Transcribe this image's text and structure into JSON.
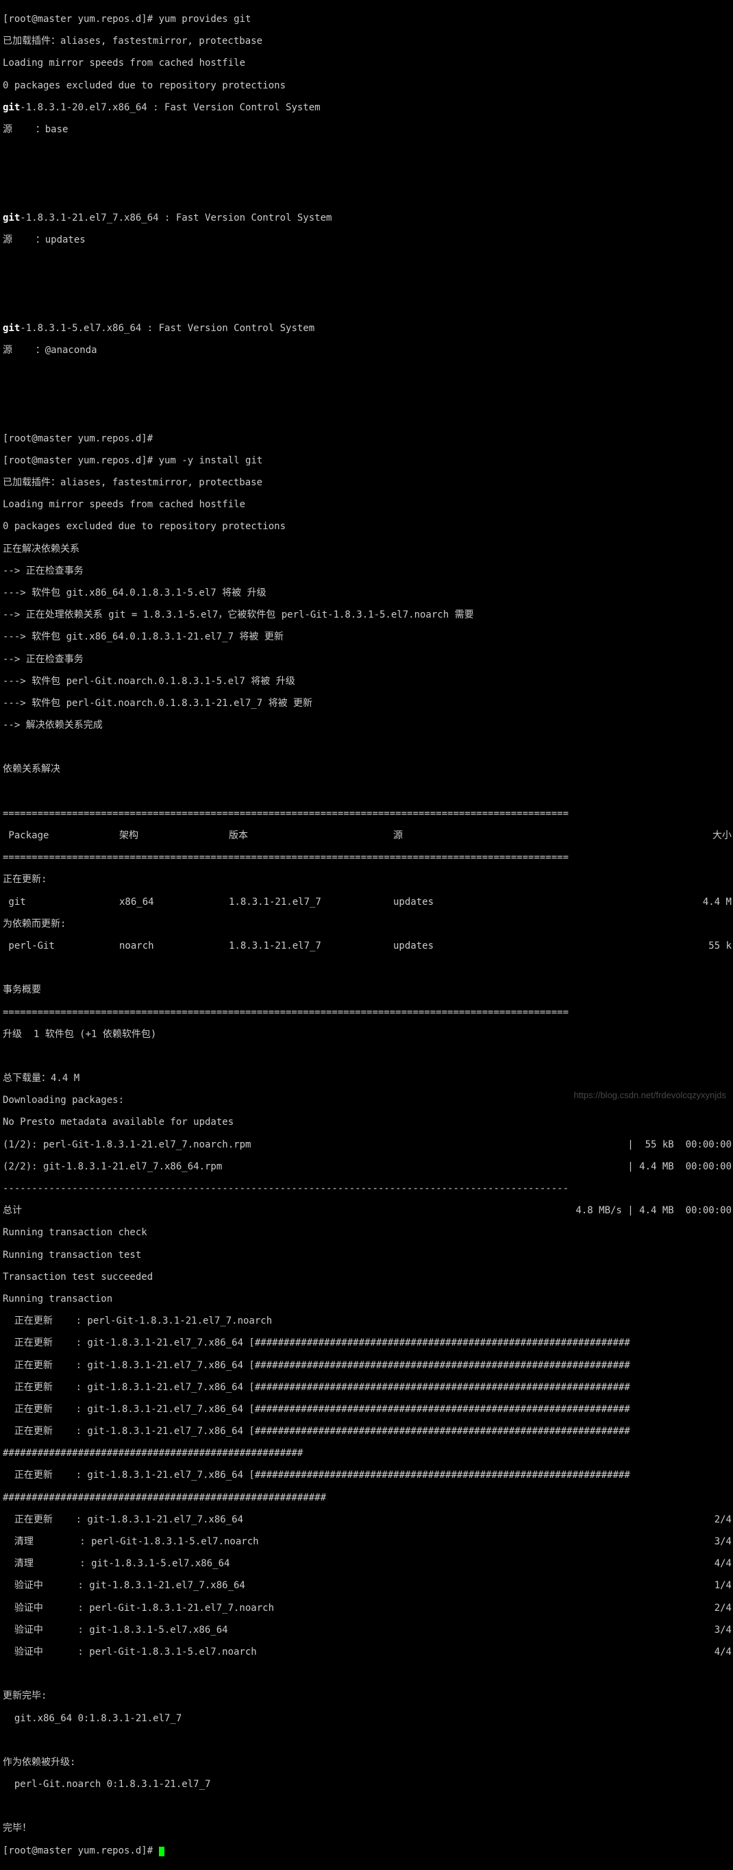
{
  "prompt_prefix": "[root@master yum.repos.d]# ",
  "cmd_provides": "yum provides git",
  "plugins_line": "已加载插件：aliases, fastestmirror, protectbase",
  "loading_speeds": "Loading mirror speeds from cached hostfile",
  "excl_line": "0 packages excluded due to repository protections",
  "pkg1_name": "git",
  "pkg1_rest": "-1.8.3.1-20.el7.x86_64 : Fast Version Control System",
  "pkg1_src": "源    ：base",
  "pkg2_name": "git",
  "pkg2_rest": "-1.8.3.1-21.el7_7.x86_64 : Fast Version Control System",
  "pkg2_src": "源    ：updates",
  "pkg3_name": "git",
  "pkg3_rest": "-1.8.3.1-5.el7.x86_64 : Fast Version Control System",
  "pkg3_src": "源    ：@anaconda",
  "cmd_install": "yum -y install git",
  "solving_dep": "正在解决依赖关系",
  "check_trans": "--> 正在检查事务",
  "pkg_git_upgrade": "---> 软件包 git.x86_64.0.1.8.3.1-5.el7 将被 升级",
  "dep_git": "--> 正在处理依赖关系 git = 1.8.3.1-5.el7，它被软件包 perl-Git-1.8.3.1-5.el7.noarch 需要",
  "pkg_git_update": "---> 软件包 git.x86_64.0.1.8.3.1-21.el7_7 将被 更新",
  "pkg_pg_upgrade": "---> 软件包 perl-Git.noarch.0.1.8.3.1-5.el7 将被 升级",
  "pkg_pg_update": "---> 软件包 perl-Git.noarch.0.1.8.3.1-21.el7_7 将被 更新",
  "dep_done": "--> 解决依赖关系完成",
  "dep_resolved": "依赖关系解决",
  "hdr_package": " Package",
  "hdr_arch": "架构",
  "hdr_version": "版本",
  "hdr_repo": "源",
  "hdr_size": "大小",
  "updating_hdr": "正在更新:",
  "row1_pkg": " git",
  "row1_arch": "x86_64",
  "row1_ver": "1.8.3.1-21.el7_7",
  "row1_repo": "updates",
  "row1_size": "4.4 M",
  "dep_update_hdr": "为依赖而更新:",
  "row2_pkg": " perl-Git",
  "row2_arch": "noarch",
  "row2_ver": "1.8.3.1-21.el7_7",
  "row2_repo": "updates",
  "row2_size": "55 k",
  "trans_summary": "事务概要",
  "upgrade_summary": "升级  1 软件包 (+1 依赖软件包)",
  "total_dl": "总下载量：4.4 M",
  "dl_packages": "Downloading packages:",
  "no_presto": "No Presto metadata available for updates",
  "dl1_left": "(1/2): perl-Git-1.8.3.1-21.el7_7.noarch.rpm",
  "dl1_right": "|  55 kB  00:00:00",
  "dl2_left": "(2/2): git-1.8.3.1-21.el7_7.x86_64.rpm",
  "dl2_right": "| 4.4 MB  00:00:00",
  "total_label": "总计",
  "total_right": "4.8 MB/s | 4.4 MB  00:00:00",
  "run_check": "Running transaction check",
  "run_test": "Running transaction test",
  "test_ok": "Transaction test succeeded",
  "run_trans": "Running transaction",
  "u_pg": "  正在更新    : perl-Git-1.8.3.1-21.el7_7.noarch",
  "u_git": "  正在更新    : git-1.8.3.1-21.el7_7.x86_64 [#################################################################",
  "u_git2": "  正在更新    : git-1.8.3.1-21.el7_7.x86_64 [#################################################################",
  "u_git3": "  正在更新    : git-1.8.3.1-21.el7_7.x86_64 [#################################################################",
  "u_git4": "  正在更新    : git-1.8.3.1-21.el7_7.x86_64 [#################################################################",
  "u_git5": "  正在更新    : git-1.8.3.1-21.el7_7.x86_64 [#################################################################",
  "hash_line1": "####################################################",
  "u_git6": "  正在更新    : git-1.8.3.1-21.el7_7.x86_64 [#################################################################",
  "hash_line2": "########################################################",
  "u_git7_left": "  正在更新    : git-1.8.3.1-21.el7_7.x86_64",
  "u_git7_right": "2/4",
  "clean_pg_left": "  清理        : perl-Git-1.8.3.1-5.el7.noarch",
  "clean_pg_right": "3/4",
  "clean_git_left": "  清理        : git-1.8.3.1-5.el7.x86_64",
  "clean_git_right": "4/4",
  "ver_git21_left": "  验证中      : git-1.8.3.1-21.el7_7.x86_64",
  "ver_git21_right": "1/4",
  "ver_pg21_left": "  验证中      : perl-Git-1.8.3.1-21.el7_7.noarch",
  "ver_pg21_right": "2/4",
  "ver_git5_left": "  验证中      : git-1.8.3.1-5.el7.x86_64",
  "ver_git5_right": "3/4",
  "ver_pg5_left": "  验证中      : perl-Git-1.8.3.1-5.el7.noarch",
  "ver_pg5_right": "4/4",
  "update_complete": "更新完毕:",
  "upd_git": "  git.x86_64 0:1.8.3.1-21.el7_7",
  "as_dep_upg": "作为依赖被升级:",
  "upd_pg": "  perl-Git.noarch 0:1.8.3.1-21.el7_7",
  "done": "完毕！",
  "watermark": "https://blog.csdn.net/frdevolcqzyxynjds",
  "eq_line": "==================================================================================================",
  "dash_line": "--------------------------------------------------------------------------------------------------"
}
